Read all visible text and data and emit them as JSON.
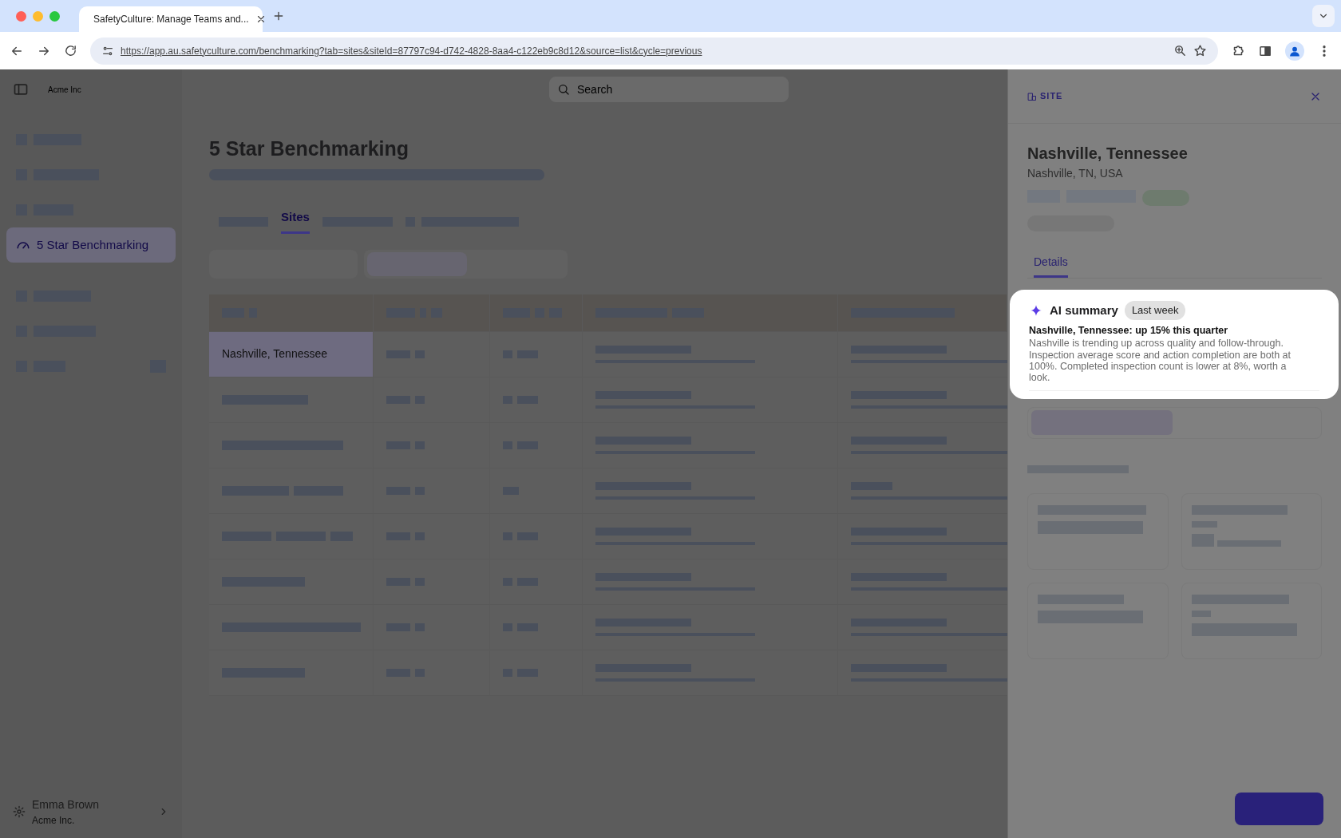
{
  "browser": {
    "tab_title": "SafetyCulture: Manage Teams and...",
    "url": "https://app.au.safetyculture.com/benchmarking?tab=sites&siteId=87797c94-d742-4828-8aa4-c122eb9c8d12&source=list&cycle=previous"
  },
  "header": {
    "org": "Acme Inc",
    "search": {
      "placeholder": "Search"
    }
  },
  "sidebar": {
    "items": [
      {
        "kind": "skeleton",
        "selected": false
      },
      {
        "kind": "skeleton",
        "selected": false
      },
      {
        "kind": "skeleton",
        "selected": false
      },
      {
        "kind": "label",
        "label": "5 Star Benchmarking",
        "selected": true
      },
      {
        "kind": "skeleton",
        "selected": false
      },
      {
        "kind": "skeleton",
        "selected": false
      },
      {
        "kind": "skeleton",
        "selected": false
      }
    ]
  },
  "page": {
    "title": "5 Star Benchmarking",
    "tabs": [
      {
        "kind": "skeleton",
        "selected": false
      },
      {
        "kind": "label",
        "label": "Sites",
        "selected": true
      },
      {
        "kind": "skeleton",
        "selected": false
      },
      {
        "kind": "skeleton",
        "selected": false
      }
    ]
  },
  "table": {
    "rows": [
      {
        "kind": "label",
        "site": "Nashville, Tennessee",
        "selected": true
      },
      {
        "kind": "skeleton",
        "selected": false
      },
      {
        "kind": "skeleton",
        "selected": false
      },
      {
        "kind": "skeleton",
        "selected": false
      },
      {
        "kind": "skeleton",
        "selected": false
      },
      {
        "kind": "skeleton",
        "selected": false
      },
      {
        "kind": "skeleton",
        "selected": false
      },
      {
        "kind": "skeleton",
        "selected": false
      }
    ]
  },
  "user": {
    "name": "Emma Brown",
    "org": "Acme Inc."
  },
  "panel": {
    "label": "SITE",
    "title": "Nashville, Tennessee",
    "subtitle": "Nashville, TN, USA",
    "tabs": [
      {
        "label": "Details",
        "selected": true
      }
    ],
    "ai_summary": {
      "title": "AI summary",
      "badge": "Last week",
      "headline": "Nashville, Tennessee: up 15% this quarter",
      "body": "Nashville is trending up across quality and follow-through. Inspection average score and action completion are both at 100%. Completed inspection count is lower at 8%, worth a look."
    }
  }
}
